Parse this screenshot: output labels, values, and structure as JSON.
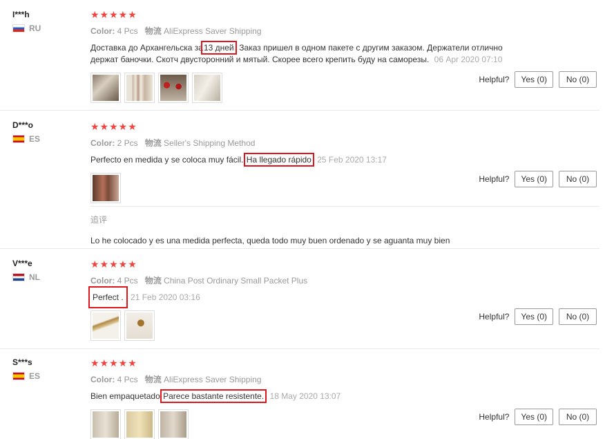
{
  "labels": {
    "color": "Color:",
    "shipping": "物流",
    "helpful": "Helpful?",
    "stars": "★★★★★"
  },
  "reviews": [
    {
      "user": "I***h",
      "country": "RU",
      "flag": "ru",
      "color_value": "4 Pcs",
      "shipping_method": "AliExpress Saver Shipping",
      "text_before": "Доставка до Архангельска за",
      "text_highlight": "13 дней",
      "text_after": ". Заказ пришел в одном пакете с другим заказом. Держатели отлично держат баночки. Скотч двусторонний и мятый. Скорее всего крепить буду на саморезы.",
      "date": "06 Apr 2020 07:10",
      "yes": "Yes (0)",
      "no": "No (0)"
    },
    {
      "user": "D***o",
      "country": "ES",
      "flag": "es",
      "color_value": "2 Pcs",
      "shipping_method": "Seller's Shipping Method",
      "text_before": "Perfecto en medida y se coloca muy fácil.",
      "text_highlight": "Ha llegado rápido",
      "text_after": "",
      "date": "25 Feb 2020 13:17",
      "yes": "Yes (0)",
      "no": "No (0)",
      "followup_title": "追评",
      "followup_text": "Lo he colocado y es una medida perfecta, queda todo muy buen ordenado y se aguanta muy bien"
    },
    {
      "user": "V***e",
      "country": "NL",
      "flag": "nl",
      "color_value": "4 Pcs",
      "shipping_method": "China Post Ordinary Small Packet Plus",
      "text_before": "",
      "text_highlight": "Perfect .",
      "text_after": "",
      "date": "21 Feb 2020 03:16",
      "yes": "Yes (0)",
      "no": "No (0)"
    },
    {
      "user": "S***s",
      "country": "ES",
      "flag": "es",
      "color_value": "4 Pcs",
      "shipping_method": "AliExpress Saver Shipping",
      "text_before": "Bien empaquetado.",
      "text_highlight": "Parece bastante resistente.",
      "text_after": "",
      "date": "18 May 2020 13:07",
      "yes": "Yes (0)",
      "no": "No (0)"
    }
  ],
  "colors": {
    "star": "#f0443e",
    "highlight_box": "#e0141b",
    "muted_text": "#999999"
  }
}
